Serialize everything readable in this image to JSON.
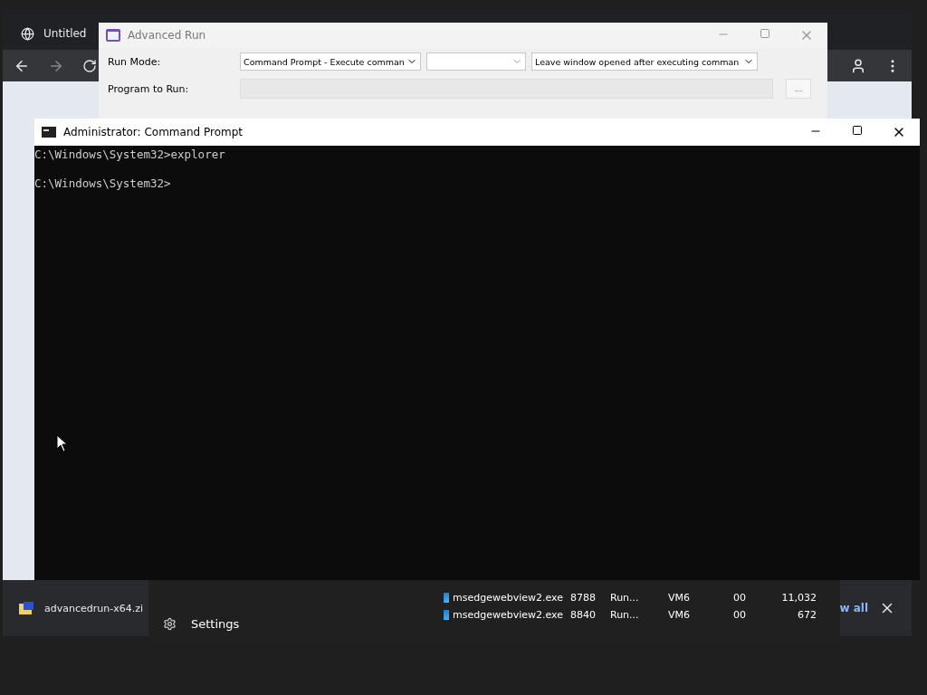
{
  "browser": {
    "tab": {
      "title": "Untitled"
    },
    "download": {
      "file": "advancedrun-x64.zi",
      "show_all": "w all"
    }
  },
  "advanced_run": {
    "title": "Advanced Run",
    "run_mode_label": "Run Mode:",
    "run_mode": "Command Prompt - Execute comman",
    "window_option": "Leave window opened after executing comman",
    "program_label": "Program to Run:",
    "browse": "..."
  },
  "task_manager": {
    "settings": "Settings",
    "rows": [
      {
        "name": "msedgewebview2.exe",
        "pid": "8788",
        "status": "Run...",
        "user": "VM6",
        "cpu": "00",
        "memory": "11,032"
      },
      {
        "name": "msedgewebview2.exe",
        "pid": "8840",
        "status": "Run...",
        "user": "VM6",
        "cpu": "00",
        "memory": "672"
      }
    ]
  },
  "console": {
    "title": "Administrator:  Command Prompt",
    "lines": [
      "C:\\Windows\\System32>explorer",
      "C:\\Windows\\System32>"
    ]
  }
}
